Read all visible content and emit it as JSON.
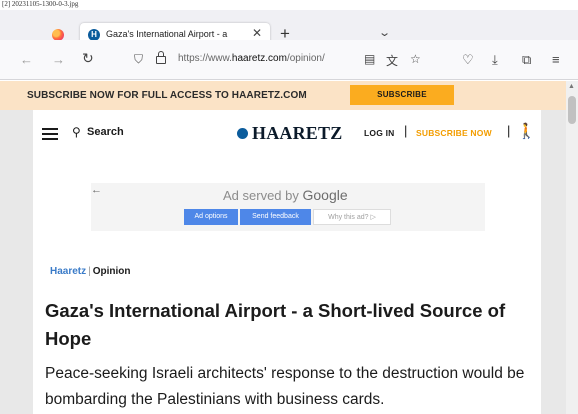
{
  "caption": "[2] 20231105-1300-0-3.jpg",
  "browser": {
    "tab_title": "Gaza's International Airport - a",
    "tab_close": "✕",
    "new_tab": "+",
    "tab_list": "⌄",
    "url_prefix": "https://www.",
    "url_domain": "haaretz.com",
    "url_rest": "/opinion/",
    "icons": [
      "back-icon",
      "forward-icon",
      "reload-icon",
      "shield-icon",
      "lock-icon",
      "reader-icon",
      "translate-icon",
      "bookmark-star-icon",
      "pocket-icon",
      "download-icon",
      "extensions-icon",
      "menu-icon"
    ]
  },
  "promo": {
    "text": "SUBSCRIBE NOW FOR FULL ACCESS TO HAARETZ.COM",
    "button": "SUBSCRIBE"
  },
  "header": {
    "search_label": "Search",
    "logo_text": "HAARETZ",
    "login": "LOG IN",
    "separator": "|",
    "subscribe_now": "SUBSCRIBE NOW",
    "accessibility": "🚶"
  },
  "ad": {
    "back": "←",
    "served_by": "Ad served by",
    "google": "Google",
    "ad_options": "Ad options",
    "send_feedback": "Send feedback",
    "why_this_ad": "Why this ad? ▷"
  },
  "article": {
    "section": "Haaretz",
    "section_sep": "|",
    "type": "Opinion",
    "headline": "Gaza's International Airport - a Short-lived Source of Hope",
    "subhead": "Peace-seeking Israeli architects' response to the destruction would be bombarding the Palestinians with business cards."
  },
  "colors": {
    "promo_bg": "#fbe3c6",
    "promo_button": "#fbac1f",
    "subscribe_now": "#f39d00",
    "section_link": "#3a7bc8",
    "ad_button": "#4e87e8",
    "brand": "#0b5c9c"
  }
}
